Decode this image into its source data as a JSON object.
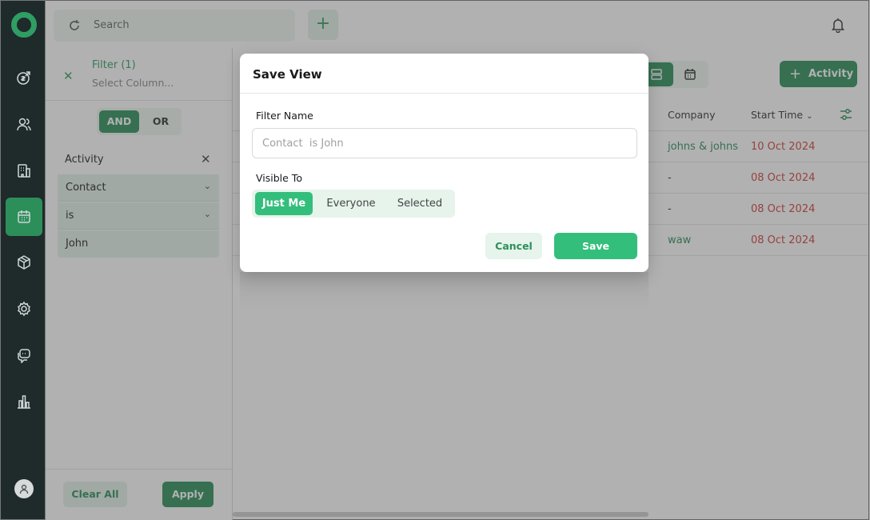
{
  "search": {
    "placeholder": "Search"
  },
  "top": {
    "add_label": "+"
  },
  "sidebar": {
    "icons": [
      "deals-icon",
      "contacts-icon",
      "companies-icon",
      "activities-icon",
      "products-icon",
      "settings-icon",
      "chat-icon",
      "reports-icon"
    ],
    "active": "activities-icon"
  },
  "filter": {
    "title": "Filter (1)",
    "select_column": "Select Column...",
    "and_label": "AND",
    "or_label": "OR",
    "group_label": "Activity",
    "field": "Contact",
    "operator": "is",
    "value": "John",
    "clear_label": "Clear All",
    "apply_label": "Apply"
  },
  "toolbar": {
    "activity_label": "Activity"
  },
  "table": {
    "headers": {
      "company": "Company",
      "start_time": "Start Time"
    },
    "rows": [
      {
        "company": "johns & johns",
        "start_time": "10 Oct 2024"
      },
      {
        "company": "-",
        "start_time": "08 Oct 2024"
      },
      {
        "company": "-",
        "start_time": "08 Oct 2024"
      },
      {
        "company": "waw",
        "start_time": "08 Oct 2024"
      }
    ]
  },
  "modal": {
    "title": "Save View",
    "filter_name_label": "Filter Name",
    "filter_name_placeholder": "Contact  is John",
    "visible_to_label": "Visible To",
    "visibility_options": [
      "Just Me",
      "Everyone",
      "Selected"
    ],
    "selected_option": "Just Me",
    "cancel_label": "Cancel",
    "save_label": "Save"
  },
  "colors": {
    "primary": "#2c8f5a",
    "accent": "#34be7c",
    "sidebar_bg": "#1f2a2b",
    "danger_text": "#d0403d"
  }
}
